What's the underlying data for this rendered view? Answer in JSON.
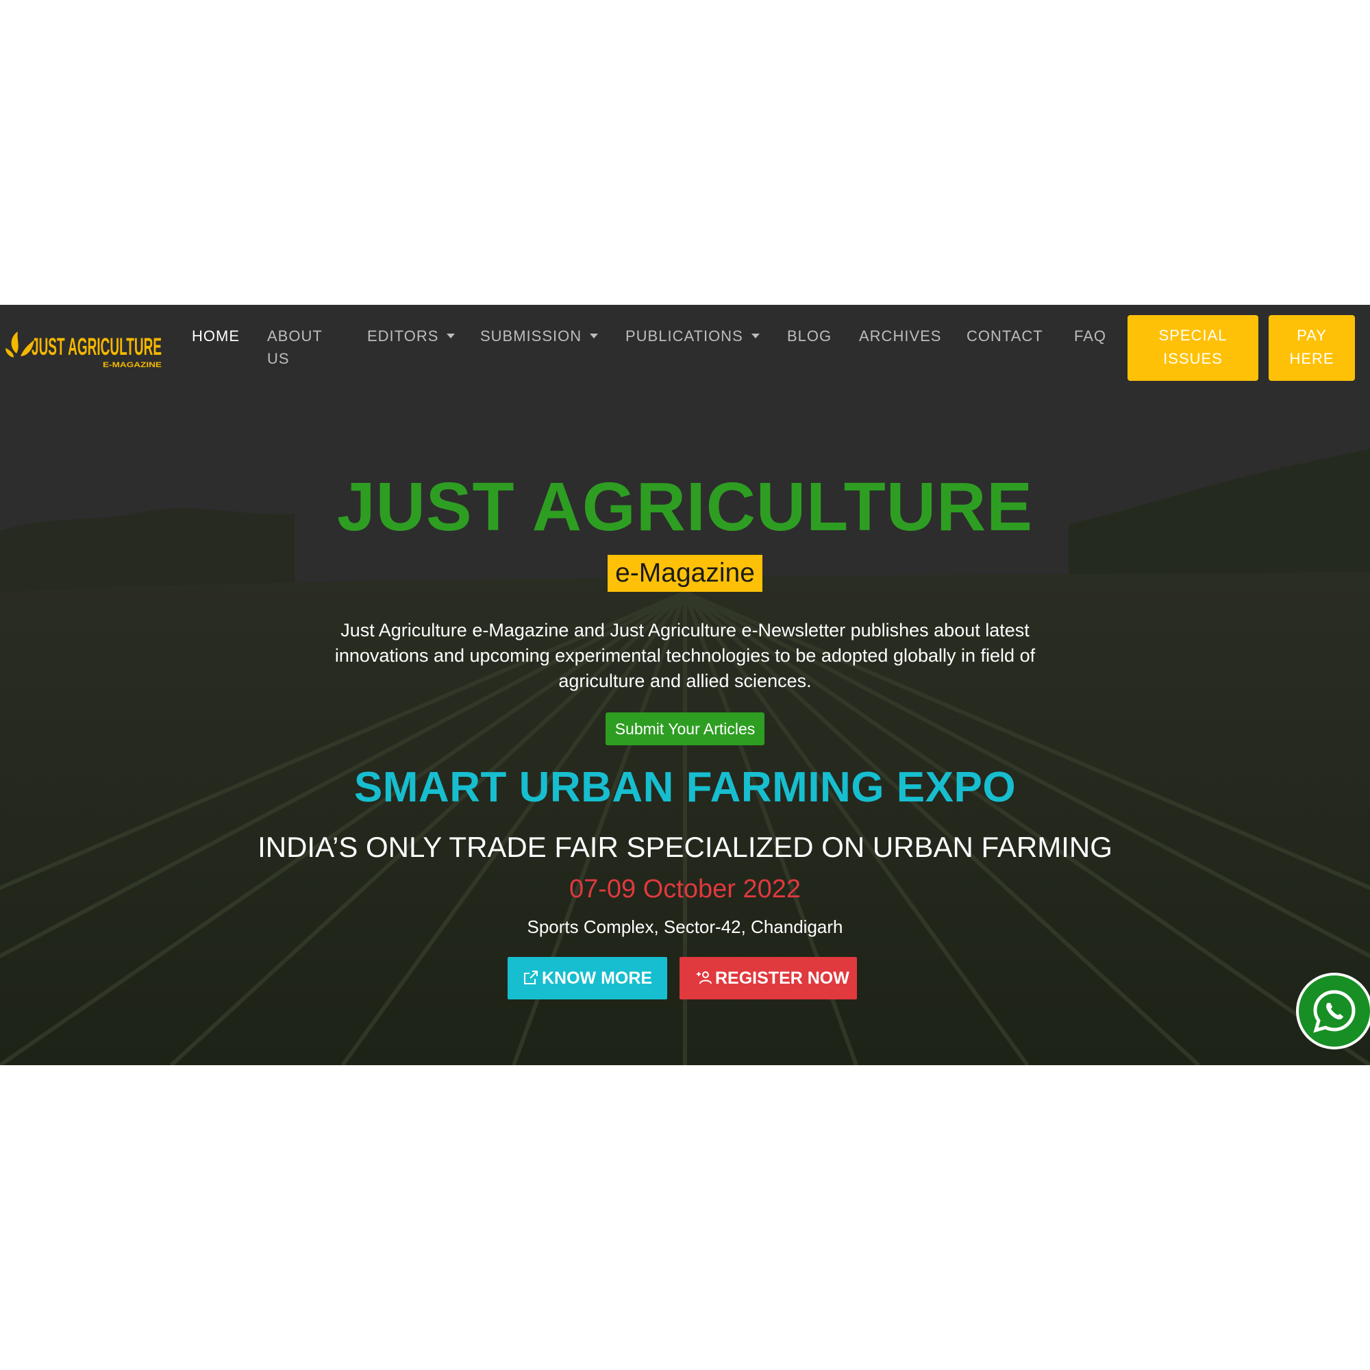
{
  "brand": {
    "logo_text": "JUST AGRICULTURE",
    "logo_subtext": "E-MAGAZINE",
    "logo_color": "#f5b800"
  },
  "nav": {
    "home": "HOME",
    "about_line1": "ABOUT",
    "about_line2": "US",
    "editors": "EDITORS",
    "submission": "SUBMISSION",
    "publications": "PUBLICATIONS",
    "blog": "BLOG",
    "archives": "ARCHIVES",
    "contact": "CONTACT",
    "faq": "FAQ",
    "special_line1": "SPECIAL",
    "special_line2": "ISSUES",
    "pay_line1": "PAY",
    "pay_line2": "HERE"
  },
  "hero": {
    "title": "JUST AGRICULTURE",
    "badge": "e-Magazine",
    "description": "Just Agriculture e-Magazine and Just Agriculture e-Newsletter publishes about latest innovations and upcoming experimental technologies to be adopted globally in field of agriculture and allied sciences.",
    "submit_label": "Submit Your Articles"
  },
  "expo": {
    "title": "SMART URBAN FARMING EXPO",
    "subtitle": "INDIA’S ONLY TRADE FAIR SPECIALIZED ON URBAN FARMING",
    "date": "07-09 October 2022",
    "venue": "Sports Complex, Sector-42, Chandigarh",
    "know_more_label": "KNOW MORE",
    "register_label": "REGISTER NOW"
  },
  "colors": {
    "green": "#2e9e22",
    "yellow": "#ffc107",
    "cyan": "#17becf",
    "red": "#e0393e",
    "whatsapp": "#178f24"
  },
  "icons": {
    "know_more": "external-link-icon",
    "register": "user-add-icon",
    "chat": "whatsapp-icon",
    "dropdown": "caret-down-icon"
  }
}
